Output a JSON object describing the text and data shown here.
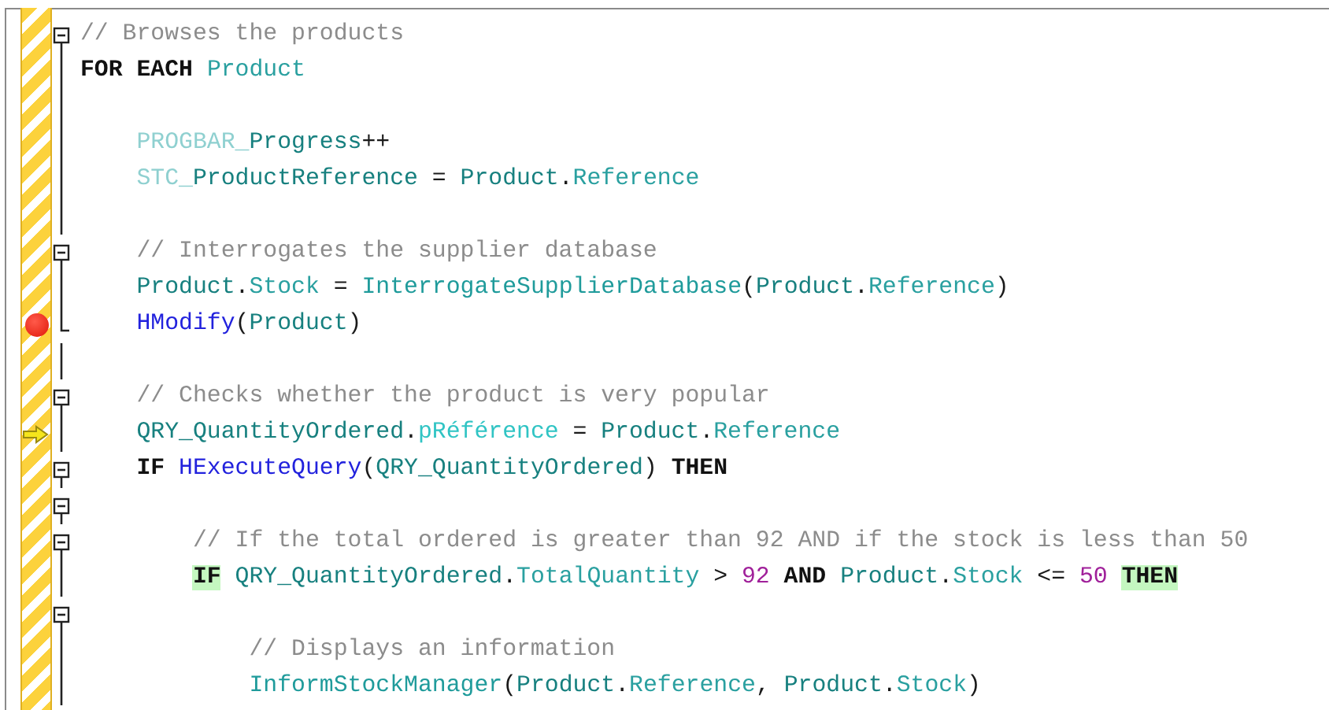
{
  "lines": [
    {
      "fold_start": true,
      "fold_end": false,
      "breakpoint": false,
      "current": false,
      "tokens": [
        {
          "text": "// Browses the products",
          "kind": "comment"
        }
      ]
    },
    {
      "fold_start": false,
      "fold_end": false,
      "breakpoint": false,
      "current": false,
      "tokens": [
        {
          "text": "FOR EACH ",
          "kind": "keyword"
        },
        {
          "text": "Product",
          "kind": "variable"
        }
      ],
      "children": [
        {
          "fold_start": false,
          "fold_end": false,
          "breakpoint": false,
          "current": false
        },
        {
          "fold_start": false,
          "fold_end": false,
          "breakpoint": false,
          "current": false,
          "tokens": [
            {
              "text": "PROGBAR_",
              "kind": "control_prefix"
            },
            {
              "text": "Progress",
              "kind": "control_name"
            },
            {
              "text": "++",
              "kind": "plain"
            }
          ]
        },
        {
          "fold_start": false,
          "fold_end": false,
          "breakpoint": false,
          "current": false,
          "tokens": [
            {
              "text": "STC_",
              "kind": "control_prefix"
            },
            {
              "text": "ProductReference",
              "kind": "control_name"
            },
            {
              "text": " = ",
              "kind": "plain"
            },
            {
              "text": "Product",
              "kind": "control_name"
            },
            {
              "text": ".",
              "kind": "plain"
            },
            {
              "text": "Reference",
              "kind": "variable"
            }
          ]
        },
        {
          "fold_start": false,
          "fold_end": false,
          "breakpoint": false,
          "current": false
        },
        {
          "fold_start": true,
          "fold_end": false,
          "breakpoint": false,
          "current": false,
          "tokens": [
            {
              "text": "// Interrogates the supplier database",
              "kind": "comment"
            }
          ]
        },
        {
          "fold_start": false,
          "fold_end": false,
          "breakpoint": false,
          "current": false,
          "tokens": [
            {
              "text": "Product",
              "kind": "control_name"
            },
            {
              "text": ".",
              "kind": "plain"
            },
            {
              "text": "Stock",
              "kind": "variable"
            },
            {
              "text": " = ",
              "kind": "plain"
            },
            {
              "text": "InterrogateSupplierDatabase",
              "kind": "procedure"
            },
            {
              "text": "(",
              "kind": "plain"
            },
            {
              "text": "Product",
              "kind": "control_name"
            },
            {
              "text": ".",
              "kind": "plain"
            },
            {
              "text": "Reference",
              "kind": "variable"
            },
            {
              "text": ")",
              "kind": "plain"
            }
          ]
        },
        {
          "fold_start": false,
          "fold_end": true,
          "breakpoint": true,
          "current": false,
          "tokens": [
            {
              "text": "HModify",
              "kind": "function"
            },
            {
              "text": "(",
              "kind": "plain"
            },
            {
              "text": "Product",
              "kind": "control_name"
            },
            {
              "text": ")",
              "kind": "plain"
            }
          ]
        },
        {
          "fold_start": false,
          "fold_end": false,
          "breakpoint": false,
          "current": false
        },
        {
          "fold_start": true,
          "fold_end": false,
          "breakpoint": false,
          "current": false,
          "tokens": [
            {
              "text": "// Checks whether the product is very popular",
              "kind": "comment"
            }
          ]
        },
        {
          "fold_start": false,
          "fold_end": false,
          "breakpoint": false,
          "current": true,
          "tokens": [
            {
              "text": "QRY_QuantityOrdered",
              "kind": "control_name"
            },
            {
              "text": ".",
              "kind": "plain"
            },
            {
              "text": "pRéférence",
              "kind": "parameter"
            },
            {
              "text": " = ",
              "kind": "plain"
            },
            {
              "text": "Product",
              "kind": "control_name"
            },
            {
              "text": ".",
              "kind": "plain"
            },
            {
              "text": "Reference",
              "kind": "variable"
            }
          ]
        },
        {
          "fold_start": true,
          "fold_end": false,
          "breakpoint": false,
          "current": false,
          "tokens": [
            {
              "text": "IF ",
              "kind": "keyword"
            },
            {
              "text": "HExecuteQuery",
              "kind": "function"
            },
            {
              "text": "(",
              "kind": "plain"
            },
            {
              "text": "QRY_QuantityOrdered",
              "kind": "control_name"
            },
            {
              "text": ") ",
              "kind": "plain"
            },
            {
              "text": "THEN",
              "kind": "keyword"
            }
          ],
          "children": [
            {
              "fold_start": true,
              "fold_end": false,
              "breakpoint": false,
              "current": false
            },
            {
              "fold_start": true,
              "fold_end": false,
              "breakpoint": false,
              "current": false,
              "tokens": [
                {
                  "text": "// If the total ordered is greater than 92 AND if the stock is less than 50",
                  "kind": "comment"
                }
              ]
            },
            {
              "fold_start": false,
              "fold_end": false,
              "breakpoint": false,
              "current": false,
              "tokens": [
                {
                  "text": "IF",
                  "kind": "keyword_match"
                },
                {
                  "text": " QRY_QuantityOrdered",
                  "kind": "control_name"
                },
                {
                  "text": ".",
                  "kind": "plain"
                },
                {
                  "text": "TotalQuantity",
                  "kind": "variable"
                },
                {
                  "text": " > ",
                  "kind": "plain"
                },
                {
                  "text": "92",
                  "kind": "number"
                },
                {
                  "text": " AND ",
                  "kind": "keyword"
                },
                {
                  "text": "Product",
                  "kind": "control_name"
                },
                {
                  "text": ".",
                  "kind": "plain"
                },
                {
                  "text": "Stock",
                  "kind": "variable"
                },
                {
                  "text": " <= ",
                  "kind": "plain"
                },
                {
                  "text": "50 ",
                  "kind": "number"
                },
                {
                  "text": "THEN",
                  "kind": "keyword_match"
                }
              ],
              "children": [
                {
                  "fold_start": true,
                  "fold_end": false,
                  "breakpoint": false,
                  "current": false
                },
                {
                  "fold_start": false,
                  "fold_end": false,
                  "breakpoint": false,
                  "current": false,
                  "tokens": [
                    {
                      "text": "// Displays an information",
                      "kind": "comment"
                    }
                  ]
                },
                {
                  "fold_start": false,
                  "fold_end": false,
                  "breakpoint": false,
                  "current": false,
                  "tokens": [
                    {
                      "text": "InformStockManager",
                      "kind": "procedure"
                    },
                    {
                      "text": "(",
                      "kind": "plain"
                    },
                    {
                      "text": "Product",
                      "kind": "control_name"
                    },
                    {
                      "text": ".",
                      "kind": "plain"
                    },
                    {
                      "text": "Reference",
                      "kind": "variable"
                    },
                    {
                      "text": ", ",
                      "kind": "plain"
                    },
                    {
                      "text": "Product",
                      "kind": "control_name"
                    },
                    {
                      "text": ".",
                      "kind": "plain"
                    },
                    {
                      "text": "Stock",
                      "kind": "variable"
                    },
                    {
                      "text": ")",
                      "kind": "plain"
                    }
                  ]
                }
              ]
            }
          ]
        }
      ]
    }
  ]
}
